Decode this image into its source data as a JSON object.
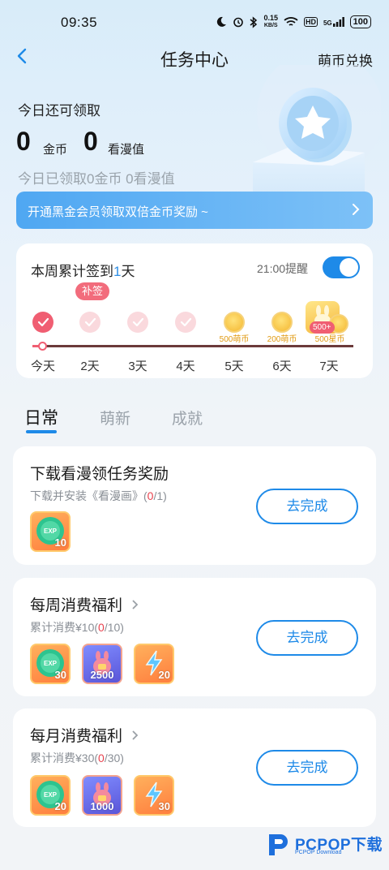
{
  "status": {
    "time": "09:35",
    "net_speed_value": "0.15",
    "net_speed_unit": "KB/S",
    "hd": "HD",
    "signal": "5G",
    "battery": "100"
  },
  "nav": {
    "title": "任务中心",
    "right_link": "萌币兑换"
  },
  "summary": {
    "label": "今日还可领取",
    "coins": "0",
    "coins_unit": "金币",
    "views": "0",
    "views_unit": "看漫值",
    "received": "今日已领取0金币 0看漫值"
  },
  "vip_banner": {
    "text": "开通黑金会员领取双倍金币奖励 ~"
  },
  "signin": {
    "title_pre": "本周累计签到",
    "count": "1",
    "title_post": "天",
    "reminder": "21:00提醒",
    "reminder_on": true,
    "makeup_badge": "补签",
    "days": [
      {
        "label": "今天",
        "state": "done"
      },
      {
        "label": "2天",
        "state": "missed"
      },
      {
        "label": "3天",
        "state": "missed"
      },
      {
        "label": "4天",
        "state": "missed"
      },
      {
        "label": "5天",
        "state": "coin",
        "reward": "500萌币"
      },
      {
        "label": "6天",
        "state": "coin",
        "reward": "200萌币"
      },
      {
        "label": "7天",
        "state": "big",
        "reward": "500星币",
        "badge": "500+"
      }
    ]
  },
  "tabs": [
    {
      "label": "日常",
      "active": true
    },
    {
      "label": "萌新",
      "active": false
    },
    {
      "label": "成就",
      "active": false
    }
  ],
  "tasks": [
    {
      "title": "下载看漫领任务奖励",
      "desc_pre": "下载并安装《看漫画》(",
      "done": "0",
      "desc_post": "/1)",
      "button": "去完成",
      "rewards": [
        {
          "icon": "exp-icon",
          "label": "EXP",
          "value": "10"
        }
      ]
    },
    {
      "title": "每周消费福利",
      "desc_pre": "累计消费¥10(",
      "done": "0",
      "desc_post": "/10)",
      "button": "去完成",
      "rewards": [
        {
          "icon": "exp-icon",
          "label": "EXP",
          "value": "30"
        },
        {
          "icon": "coin-bag-icon",
          "value": "2500"
        },
        {
          "icon": "lightning-icon",
          "value": "20"
        }
      ]
    },
    {
      "title": "每月消费福利",
      "desc_pre": "累计消费¥30(",
      "done": "0",
      "desc_post": "/30)",
      "button": "去完成",
      "rewards": [
        {
          "icon": "exp-icon",
          "label": "EXP",
          "value": "20"
        },
        {
          "icon": "coin-bag-icon",
          "value": "1000"
        },
        {
          "icon": "lightning-icon",
          "value": "30"
        }
      ]
    }
  ],
  "watermark": {
    "text": "PCPOP下载",
    "sub": "PCPOP Download"
  },
  "colors": {
    "accent": "#1e8ae8",
    "signed": "#f05e72",
    "coin": "#f4b731",
    "progress_red": "#e8424e"
  }
}
